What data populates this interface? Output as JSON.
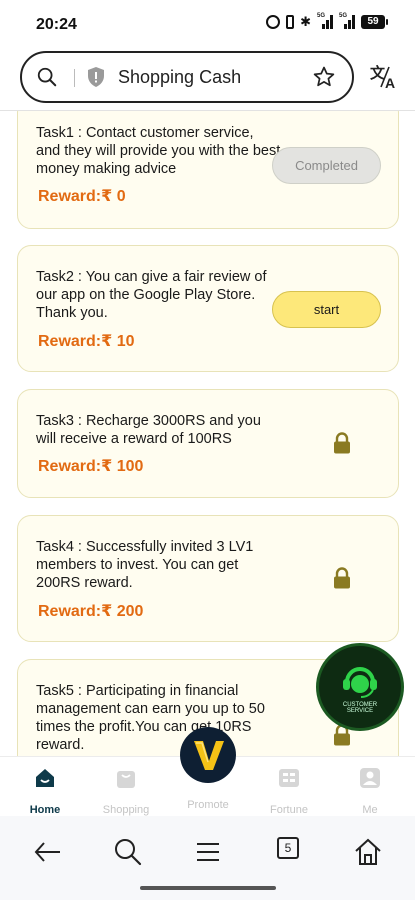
{
  "status_bar": {
    "time": "20:24",
    "signal_1": "5G",
    "signal_2": "5G",
    "battery": "59"
  },
  "browser": {
    "url_text": "Shopping Cash"
  },
  "tasks": [
    {
      "text": "Task1 : Contact customer service, and they will provide you with the best money making advice",
      "reward": "Reward:₹ 0",
      "button": "Completed",
      "state": "completed"
    },
    {
      "text": "Task2 : You can give a fair review of our app on the Google Play Store. Thank you.",
      "reward": "Reward:₹ 10",
      "button": "start",
      "state": "start"
    },
    {
      "text": "Task3 : Recharge 3000RS and you will receive a reward of 100RS",
      "reward": "Reward:₹ 100",
      "state": "locked"
    },
    {
      "text": "Task4 : Successfully invited 3 LV1 members to invest. You can get 200RS reward.",
      "reward": "Reward:₹ 200",
      "state": "locked"
    },
    {
      "text": "Task5 : Participating in financial management can earn you up to 50 times the profit.You can get 10RS reward.",
      "state": "locked"
    }
  ],
  "customer_service": {
    "label": "CUSTOMER SERVICE"
  },
  "bottom_nav": [
    {
      "label": "Home",
      "icon": "home-icon"
    },
    {
      "label": "Shopping",
      "icon": "shopping-bag-icon"
    },
    {
      "label": "Promote",
      "icon": "promote-logo"
    },
    {
      "label": "Fortune",
      "icon": "fortune-icon"
    },
    {
      "label": "Me",
      "icon": "person-icon"
    }
  ],
  "system_nav": {
    "tab_count": "5"
  },
  "colors": {
    "card_bg": "#fffdf0",
    "reward": "#e26a12",
    "start_button": "#fde87a",
    "lock": "#8a7a22"
  }
}
